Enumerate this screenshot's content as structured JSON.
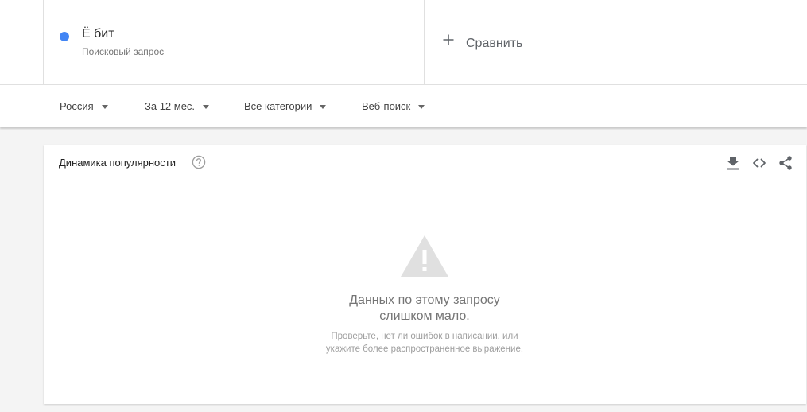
{
  "term": {
    "name": "Ё бит",
    "type": "Поисковый запрос",
    "color": "#4285f4"
  },
  "compare": {
    "label": "Сравнить",
    "icon": "plus-icon"
  },
  "filters": [
    {
      "label": "Россия",
      "icon": "caret-down-icon"
    },
    {
      "label": "За 12 мес.",
      "icon": "caret-down-icon"
    },
    {
      "label": "Все категории",
      "icon": "caret-down-icon"
    },
    {
      "label": "Веб-поиск",
      "icon": "caret-down-icon"
    }
  ],
  "interest_card": {
    "title": "Динамика популярности",
    "help_icon": "help-icon",
    "tools": [
      "download-icon",
      "embed-code-icon",
      "share-icon"
    ],
    "empty_state": {
      "icon": "warning-icon",
      "title_line1": "Данных по этому запросу",
      "title_line2": "слишком мало.",
      "hint_line1": "Проверьте, нет ли ошибок в написании, или",
      "hint_line2": "укажите более распространенное выражение."
    }
  }
}
